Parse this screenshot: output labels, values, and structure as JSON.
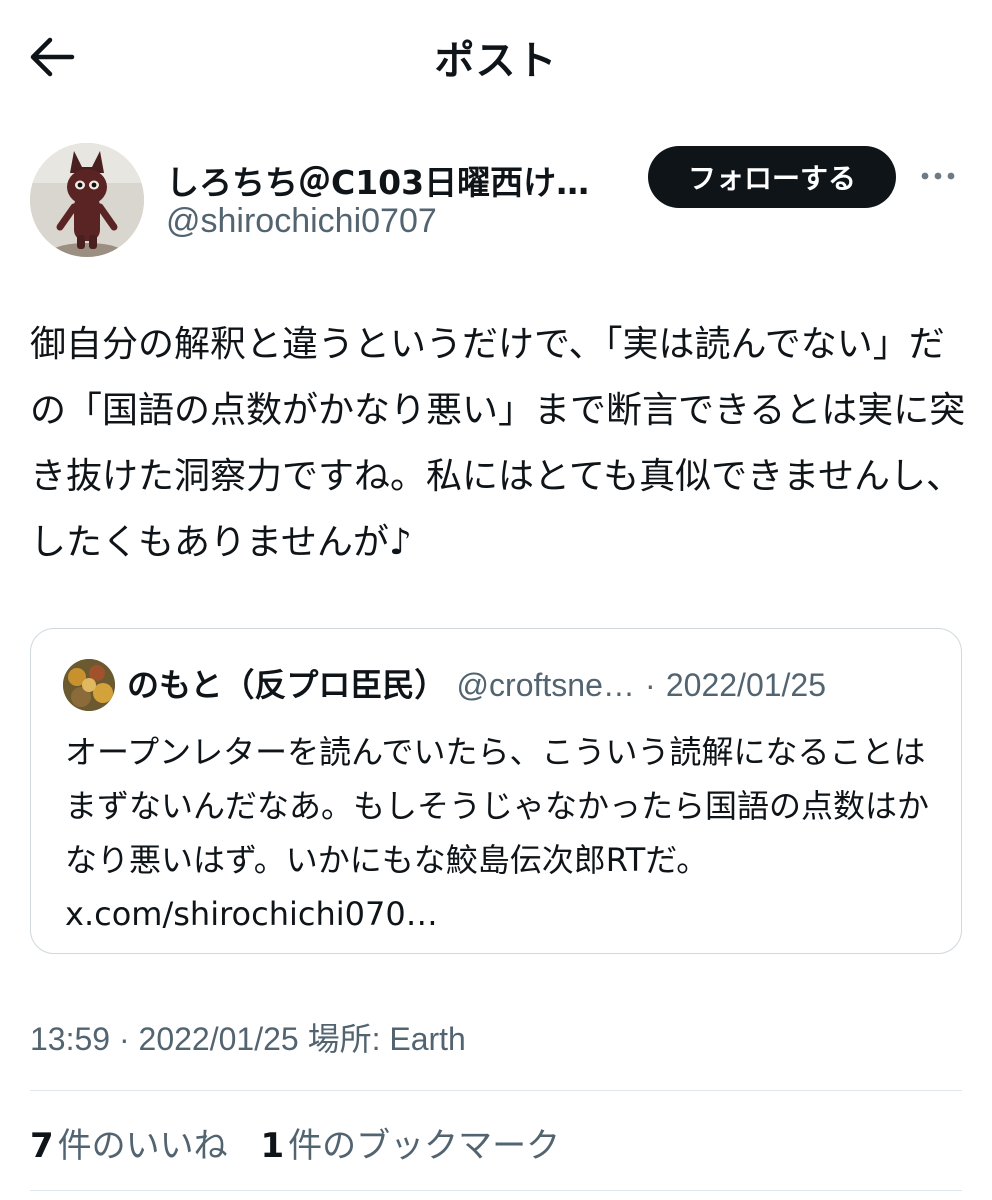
{
  "header": {
    "title": "ポスト"
  },
  "author": {
    "display_name": "しろちち＠C103日曜西け…",
    "handle": "@shirochichi0707",
    "follow_label": "フォローする"
  },
  "post": {
    "text": "御自分の解釈と違うというだけで、「実は読んでない」だの「国語の点数がかなり悪い」まで断言できるとは実に突き抜けた洞察力ですね。私にはとても真似できませんし、したくもありませんが♪"
  },
  "quote": {
    "name": "のもと（反プロ臣民）",
    "handle": "@croftsne…",
    "separator": "·",
    "date": "2022/01/25",
    "text": "オープンレターを読んでいたら、こういう読解になることはまずないんだなあ。もしそうじゃなかったら国語の点数はかなり悪いはず。いかにもな鮫島伝次郎RTだ。 x.com/shirochichi070…"
  },
  "timestamp": {
    "time": "13:59",
    "separator": "·",
    "date": "2022/01/25",
    "location_label": "場所: Earth"
  },
  "stats": [
    {
      "count": "7",
      "label": "件のいいね"
    },
    {
      "count": "1",
      "label": "件のブックマーク"
    }
  ]
}
